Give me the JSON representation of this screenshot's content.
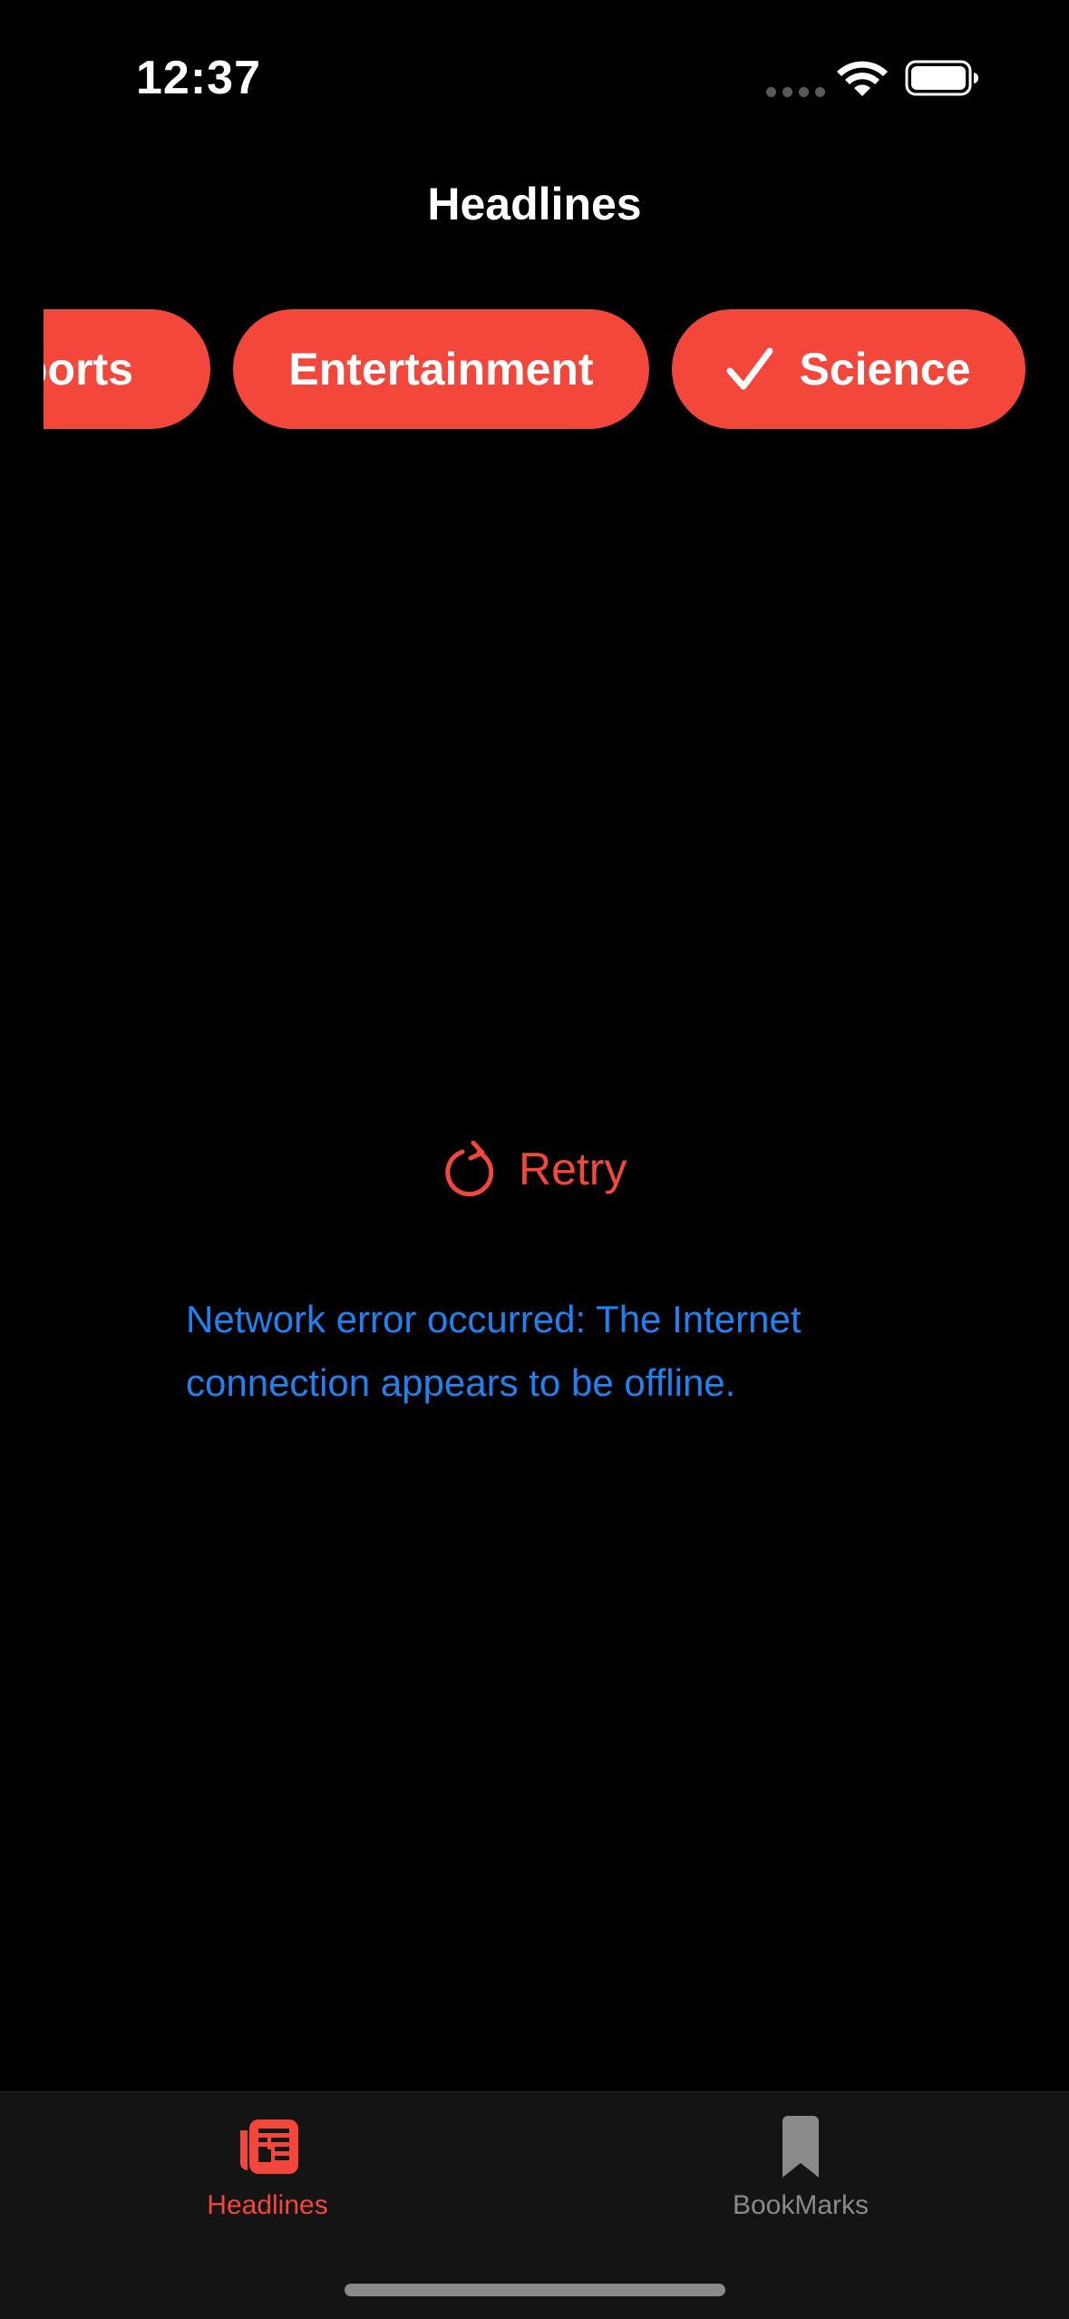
{
  "status_bar": {
    "time": "12:37"
  },
  "nav": {
    "title": "Headlines"
  },
  "categories": [
    {
      "label": "ports",
      "selected": false
    },
    {
      "label": "Entertainment",
      "selected": false
    },
    {
      "label": "Science",
      "selected": true
    }
  ],
  "retry": {
    "label": "Retry",
    "icon": "arrow-clockwise-icon"
  },
  "error": {
    "message": "Network error occurred: The Internet connection appears to be offline."
  },
  "tab_bar": {
    "tabs": [
      {
        "label": "Headlines",
        "icon": "newspaper-icon",
        "active": true
      },
      {
        "label": "BookMarks",
        "icon": "bookmark-icon",
        "active": false
      }
    ]
  },
  "colors": {
    "accent": "#f4473b",
    "error_text": "#1e82f0",
    "inactive_tab": "#8a8a8a",
    "tab_bar_bg": "#141414"
  }
}
